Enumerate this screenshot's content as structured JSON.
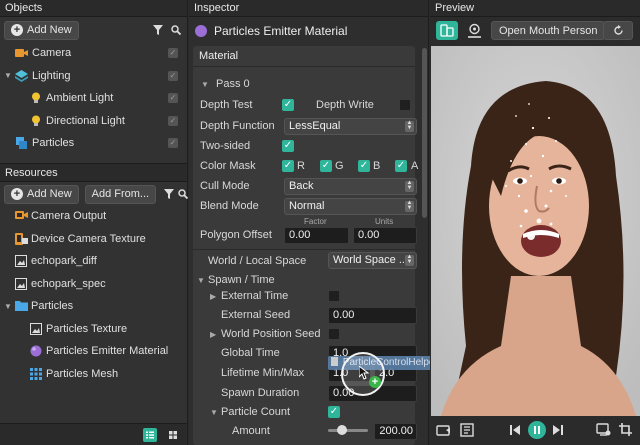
{
  "objects": {
    "title": "Objects",
    "add_new_label": "Add New",
    "items": [
      {
        "label": "Camera",
        "icon": "camera-icon"
      },
      {
        "label": "Lighting",
        "icon": "lighting-icon"
      },
      {
        "label": "Ambient Light",
        "icon": "bulb-icon"
      },
      {
        "label": "Directional Light",
        "icon": "bulb-icon"
      },
      {
        "label": "Particles",
        "icon": "particles-icon"
      }
    ]
  },
  "resources": {
    "title": "Resources",
    "add_new_label": "Add New",
    "add_from_label": "Add From...",
    "items": [
      {
        "label": "Camera Output"
      },
      {
        "label": "Device Camera Texture"
      },
      {
        "label": "echopark_diff"
      },
      {
        "label": "echopark_spec"
      },
      {
        "label": "Particles"
      },
      {
        "label": "Particles Texture"
      },
      {
        "label": "Particles Emitter Material"
      },
      {
        "label": "Particles Mesh"
      }
    ]
  },
  "inspector": {
    "title": "Inspector",
    "object_name": "Particles Emitter Material",
    "material_label": "Material",
    "pass_label": "Pass 0",
    "depth_test_label": "Depth Test",
    "depth_test": true,
    "depth_write_label": "Depth Write",
    "depth_write": false,
    "depth_function_label": "Depth Function",
    "depth_function": "LessEqual",
    "two_sided_label": "Two-sided",
    "two_sided": true,
    "color_mask_label": "Color Mask",
    "color_mask": {
      "r": "R",
      "g": "G",
      "b": "B",
      "a": "A"
    },
    "cull_mode_label": "Cull Mode",
    "cull_mode": "Back",
    "blend_mode_label": "Blend Mode",
    "blend_mode": "Normal",
    "factor_label": "Factor",
    "units_label": "Units",
    "polygon_offset_label": "Polygon Offset",
    "polygon_offset_factor": "0.00",
    "polygon_offset_units": "0.00",
    "world_local_label": "World / Local Space",
    "world_local_value": "World Space ...",
    "spawn_time_label": "Spawn / Time",
    "external_time_label": "External Time",
    "external_seed_label": "External Seed",
    "external_seed_value": "0.00",
    "world_position_seed_label": "World Position Seed",
    "global_time_label": "Global Time",
    "global_time_value": "1.0",
    "lifetime_label": "Lifetime Min/Max",
    "lifetime_min": "1.0",
    "lifetime_max": "2.0",
    "spawn_duration_label": "Spawn Duration",
    "spawn_duration_value": "0.00",
    "particle_count_label": "Particle Count",
    "amount_label": "Amount",
    "amount_value": "200.00",
    "drag_file_label": "ParticleControlHelper.js"
  },
  "preview": {
    "title": "Preview",
    "effect_button_label": "Open Mouth Person"
  },
  "colors": {
    "accent": "#2fb59a",
    "panel": "#323232",
    "field": "#1d1d1d"
  }
}
